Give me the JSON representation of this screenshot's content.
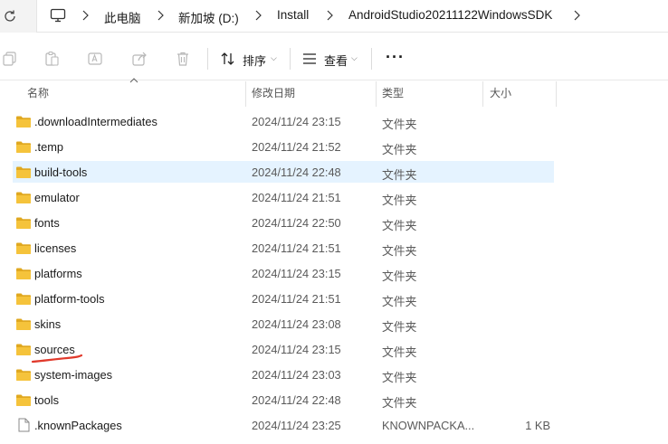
{
  "breadcrumb": {
    "items": [
      "此电脑",
      "新加坡 (D:)",
      "Install",
      "AndroidStudio20211122WindowsSDK"
    ]
  },
  "toolbar": {
    "sort_label": "排序",
    "view_label": "查看",
    "more_label": "···"
  },
  "columns": {
    "name": "名称",
    "date": "修改日期",
    "type": "类型",
    "size": "大小"
  },
  "files": [
    {
      "name": ".downloadIntermediates",
      "date": "2024/11/24 23:15",
      "type": "文件夹",
      "size": "",
      "kind": "folder"
    },
    {
      "name": ".temp",
      "date": "2024/11/24 21:52",
      "type": "文件夹",
      "size": "",
      "kind": "folder"
    },
    {
      "name": "build-tools",
      "date": "2024/11/24 22:48",
      "type": "文件夹",
      "size": "",
      "kind": "folder",
      "selected": true
    },
    {
      "name": "emulator",
      "date": "2024/11/24 21:51",
      "type": "文件夹",
      "size": "",
      "kind": "folder"
    },
    {
      "name": "fonts",
      "date": "2024/11/24 22:50",
      "type": "文件夹",
      "size": "",
      "kind": "folder"
    },
    {
      "name": "licenses",
      "date": "2024/11/24 21:51",
      "type": "文件夹",
      "size": "",
      "kind": "folder"
    },
    {
      "name": "platforms",
      "date": "2024/11/24 23:15",
      "type": "文件夹",
      "size": "",
      "kind": "folder"
    },
    {
      "name": "platform-tools",
      "date": "2024/11/24 21:51",
      "type": "文件夹",
      "size": "",
      "kind": "folder"
    },
    {
      "name": "skins",
      "date": "2024/11/24 23:08",
      "type": "文件夹",
      "size": "",
      "kind": "folder"
    },
    {
      "name": "sources",
      "date": "2024/11/24 23:15",
      "type": "文件夹",
      "size": "",
      "kind": "folder"
    },
    {
      "name": "system-images",
      "date": "2024/11/24 23:03",
      "type": "文件夹",
      "size": "",
      "kind": "folder"
    },
    {
      "name": "tools",
      "date": "2024/11/24 22:48",
      "type": "文件夹",
      "size": "",
      "kind": "folder"
    },
    {
      "name": ".knownPackages",
      "date": "2024/11/24 23:25",
      "type": "KNOWNPACKA...",
      "size": "1 KB",
      "kind": "file"
    }
  ],
  "colors": {
    "folder": "#f5c33b",
    "folder_dark": "#e0a820",
    "selection": "#e5f3ff",
    "annotation": "#e0392b"
  }
}
